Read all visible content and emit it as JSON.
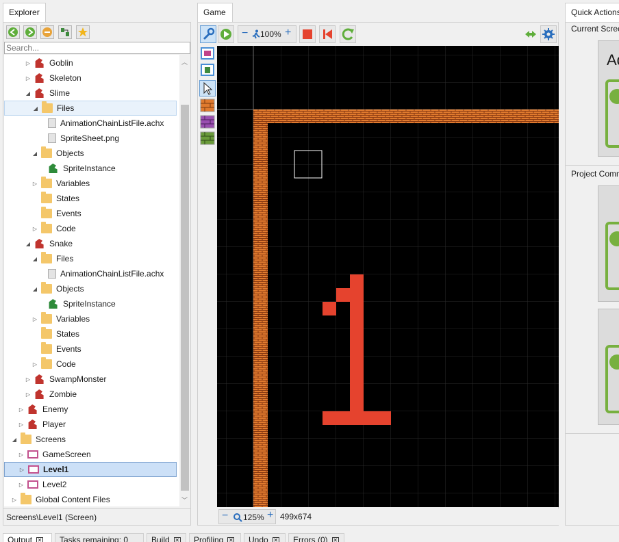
{
  "explorer": {
    "tab_label": "Explorer",
    "search_placeholder": "Search...",
    "toolbar_icons": [
      "back-icon",
      "forward-icon",
      "collapse-icon",
      "filter-icon",
      "favorite-icon"
    ],
    "status_text": "Screens\\Level1 (Screen)",
    "tree": [
      {
        "label": "Goblin",
        "icon": "entity",
        "arrow": "right",
        "indent": 2
      },
      {
        "label": "Skeleton",
        "icon": "entity",
        "arrow": "right",
        "indent": 2
      },
      {
        "label": "Slime",
        "icon": "entity",
        "arrow": "down",
        "indent": 2
      },
      {
        "label": "Files",
        "icon": "folder",
        "arrow": "down",
        "indent": 3,
        "state": "hover"
      },
      {
        "label": "AnimationChainListFile.achx",
        "icon": "file",
        "arrow": "",
        "indent": 4
      },
      {
        "label": "SpriteSheet.png",
        "icon": "file",
        "arrow": "",
        "indent": 4
      },
      {
        "label": "Objects",
        "icon": "folder",
        "arrow": "down",
        "indent": 3
      },
      {
        "label": "SpriteInstance",
        "icon": "instance",
        "arrow": "",
        "indent": 4
      },
      {
        "label": "Variables",
        "icon": "folder",
        "arrow": "right",
        "indent": 3
      },
      {
        "label": "States",
        "icon": "folder",
        "arrow": "",
        "indent": 3
      },
      {
        "label": "Events",
        "icon": "folder",
        "arrow": "",
        "indent": 3
      },
      {
        "label": "Code",
        "icon": "folder",
        "arrow": "right",
        "indent": 3
      },
      {
        "label": "Snake",
        "icon": "entity",
        "arrow": "down",
        "indent": 2
      },
      {
        "label": "Files",
        "icon": "folder",
        "arrow": "down",
        "indent": 3
      },
      {
        "label": "AnimationChainListFile.achx",
        "icon": "file",
        "arrow": "",
        "indent": 4
      },
      {
        "label": "Objects",
        "icon": "folder",
        "arrow": "down",
        "indent": 3
      },
      {
        "label": "SpriteInstance",
        "icon": "instance",
        "arrow": "",
        "indent": 4
      },
      {
        "label": "Variables",
        "icon": "folder",
        "arrow": "right",
        "indent": 3
      },
      {
        "label": "States",
        "icon": "folder",
        "arrow": "",
        "indent": 3
      },
      {
        "label": "Events",
        "icon": "folder",
        "arrow": "",
        "indent": 3
      },
      {
        "label": "Code",
        "icon": "folder",
        "arrow": "right",
        "indent": 3
      },
      {
        "label": "SwampMonster",
        "icon": "entity",
        "arrow": "right",
        "indent": 2
      },
      {
        "label": "Zombie",
        "icon": "entity",
        "arrow": "right",
        "indent": 2
      },
      {
        "label": "Enemy",
        "icon": "entity",
        "arrow": "right",
        "indent": 1
      },
      {
        "label": "Player",
        "icon": "entity",
        "arrow": "right",
        "indent": 1
      },
      {
        "label": "Screens",
        "icon": "folder",
        "arrow": "down",
        "indent": 0
      },
      {
        "label": "GameScreen",
        "icon": "screen",
        "arrow": "right",
        "indent": 1
      },
      {
        "label": "Level1",
        "icon": "screen",
        "arrow": "right",
        "indent": 1,
        "state": "selected"
      },
      {
        "label": "Level2",
        "icon": "screen",
        "arrow": "right",
        "indent": 1
      },
      {
        "label": "Global Content Files",
        "icon": "folder",
        "arrow": "right",
        "indent": 0
      }
    ]
  },
  "game": {
    "tab_label": "Game",
    "zoom_top": "100%",
    "zoom_bottom": "125%",
    "resolution": "499x674",
    "toolbar_icons": [
      "wrench-icon",
      "play-icon",
      "zoom-out-icon",
      "run-icon",
      "zoom-in-icon",
      "stop-icon",
      "restart-icon",
      "refresh-icon",
      "connection-icon",
      "settings-icon"
    ],
    "side_tools": [
      "camera-bounds-icon",
      "screenshot-icon",
      "select-pointer-icon",
      "brick-tile-orange-icon",
      "brick-tile-purple-icon",
      "brick-tile-green-icon"
    ],
    "colors": {
      "brick": "#e07a2e",
      "digit": "#e5432e",
      "canvas": "#000000"
    }
  },
  "quick_actions": {
    "tab_label": "Quick Actions",
    "current_screen_label": "Current Screen",
    "project_commands_label": "Project Commands",
    "card_letters": "Ad"
  },
  "bottom_tabs": [
    {
      "label": "Output",
      "active": true
    },
    {
      "label": "Tasks remaining: 0",
      "active": false
    },
    {
      "label": "Build",
      "active": false
    },
    {
      "label": "Profiling",
      "active": false
    },
    {
      "label": "Undo",
      "active": false
    },
    {
      "label": "Errors (0)",
      "active": false
    }
  ]
}
